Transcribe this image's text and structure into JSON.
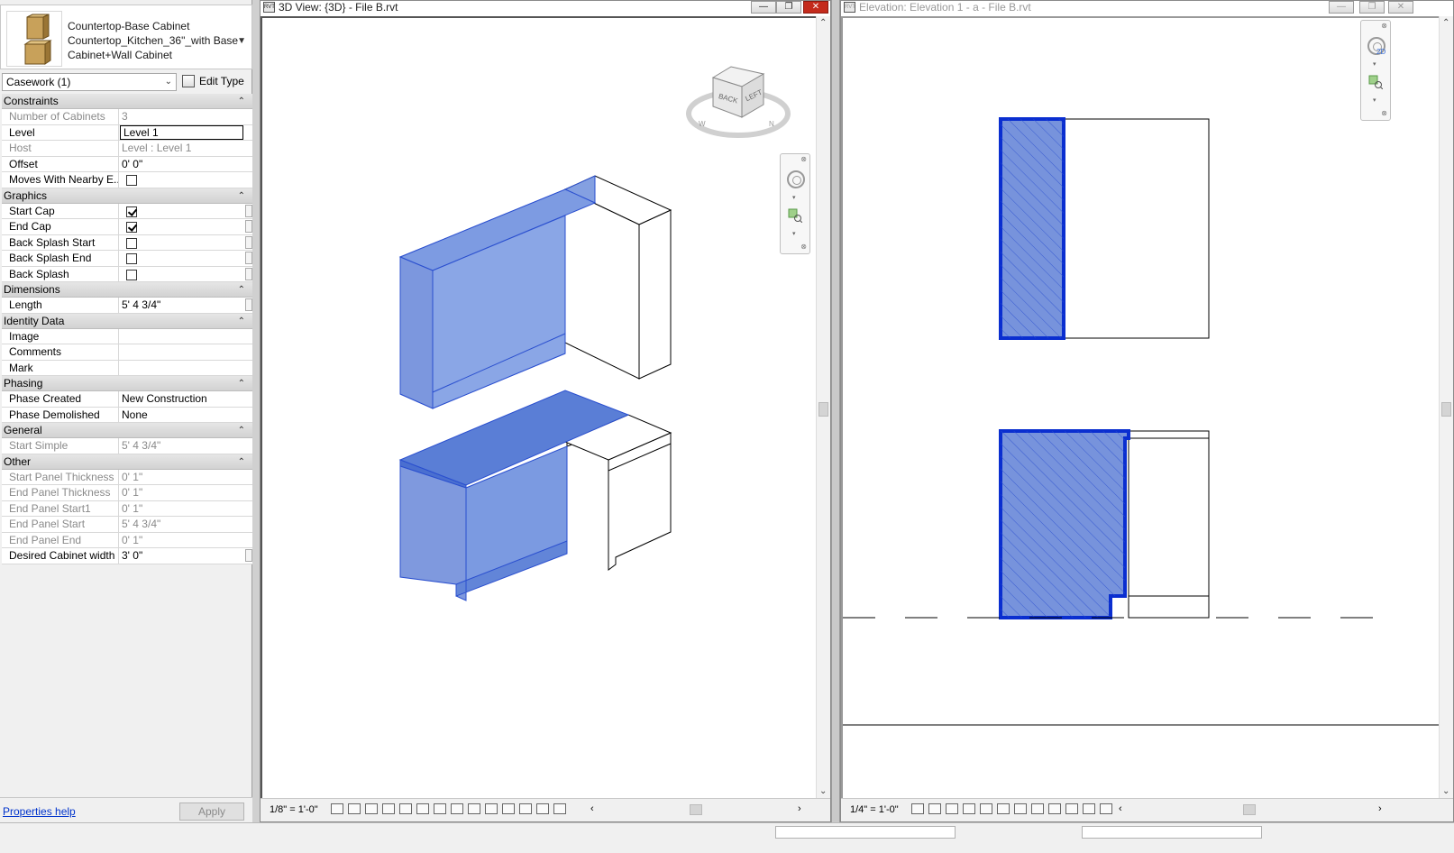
{
  "properties": {
    "type_line1": "Countertop-Base Cabinet",
    "type_line2": "Countertop_Kitchen_36\"_with Base",
    "type_line3": "Cabinet+Wall Cabinet",
    "instance_filter": "Casework (1)",
    "edit_type_label": "Edit Type",
    "help_link": "Properties help",
    "apply_label": "Apply",
    "groups": {
      "constraints": "Constraints",
      "graphics": "Graphics",
      "dimensions": "Dimensions",
      "identity": "Identity Data",
      "phasing": "Phasing",
      "general": "General",
      "other": "Other"
    },
    "rows": {
      "number_of_cabinets": {
        "label": "Number of Cabinets",
        "value": "3"
      },
      "level": {
        "label": "Level",
        "value": "Level 1"
      },
      "host": {
        "label": "Host",
        "value": "Level : Level 1"
      },
      "offset": {
        "label": "Offset",
        "value": "0'  0\""
      },
      "moves_with": {
        "label": "Moves With Nearby E...",
        "checked": false
      },
      "start_cap": {
        "label": "Start Cap",
        "checked": true
      },
      "end_cap": {
        "label": "End Cap",
        "checked": true
      },
      "back_splash_start": {
        "label": "Back Splash Start",
        "checked": false
      },
      "back_splash_end": {
        "label": "Back Splash End",
        "checked": false
      },
      "back_splash": {
        "label": "Back Splash",
        "checked": false
      },
      "length": {
        "label": "Length",
        "value": "5'  4 3/4\""
      },
      "image": {
        "label": "Image",
        "value": ""
      },
      "comments": {
        "label": "Comments",
        "value": ""
      },
      "mark": {
        "label": "Mark",
        "value": ""
      },
      "phase_created": {
        "label": "Phase Created",
        "value": "New Construction"
      },
      "phase_demolished": {
        "label": "Phase Demolished",
        "value": "None"
      },
      "start_simple": {
        "label": "Start Simple",
        "value": "5'  4 3/4\""
      },
      "start_panel_thickness": {
        "label": "Start Panel Thickness",
        "value": "0'  1\""
      },
      "end_panel_thickness": {
        "label": "End Panel Thickness",
        "value": "0'  1\""
      },
      "end_panel_start1": {
        "label": "End Panel Start1",
        "value": "0'  1\""
      },
      "end_panel_start": {
        "label": "End Panel Start",
        "value": "5'  4 3/4\""
      },
      "end_panel_end": {
        "label": "End Panel End",
        "value": "0'  1\""
      },
      "desired_cabinet_width": {
        "label": "Desired Cabinet width",
        "value": "3'  0\""
      }
    }
  },
  "view3d": {
    "title": "3D View: {3D} - File B.rvt",
    "scale": "1/8\" = 1'-0\"",
    "viewcube_back": "BACK",
    "viewcube_left": "LEFT",
    "compass_n": "N",
    "compass_w": "W"
  },
  "elevation": {
    "title": "Elevation: Elevation 1 - a - File B.rvt",
    "scale": "1/4\" = 1'-0\"",
    "nav_2d": "2D"
  },
  "colors": {
    "selection_fill": "#6f8fdc",
    "selection_stroke": "#0a2ed0"
  }
}
